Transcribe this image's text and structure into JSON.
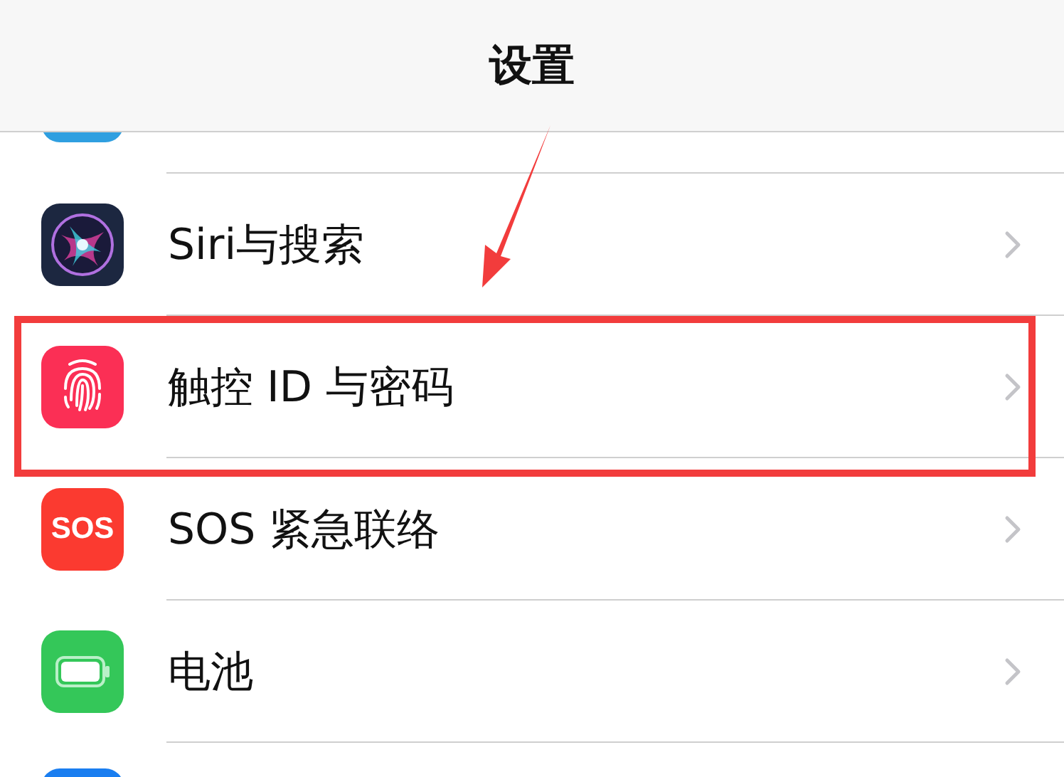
{
  "nav_bar": {
    "title": "设置"
  },
  "rows": [
    {
      "kind": "clipped-top"
    },
    {
      "kind": "siri",
      "label": "Siri与搜索"
    },
    {
      "kind": "fingerprint",
      "label": "触控 ID 与密码"
    },
    {
      "kind": "sos",
      "icon_text": "SOS",
      "label": "SOS 紧急联络"
    },
    {
      "kind": "battery",
      "label": "电池"
    },
    {
      "kind": "clipped-bottom"
    }
  ],
  "annotation": {
    "arrow": true,
    "frame": true
  }
}
